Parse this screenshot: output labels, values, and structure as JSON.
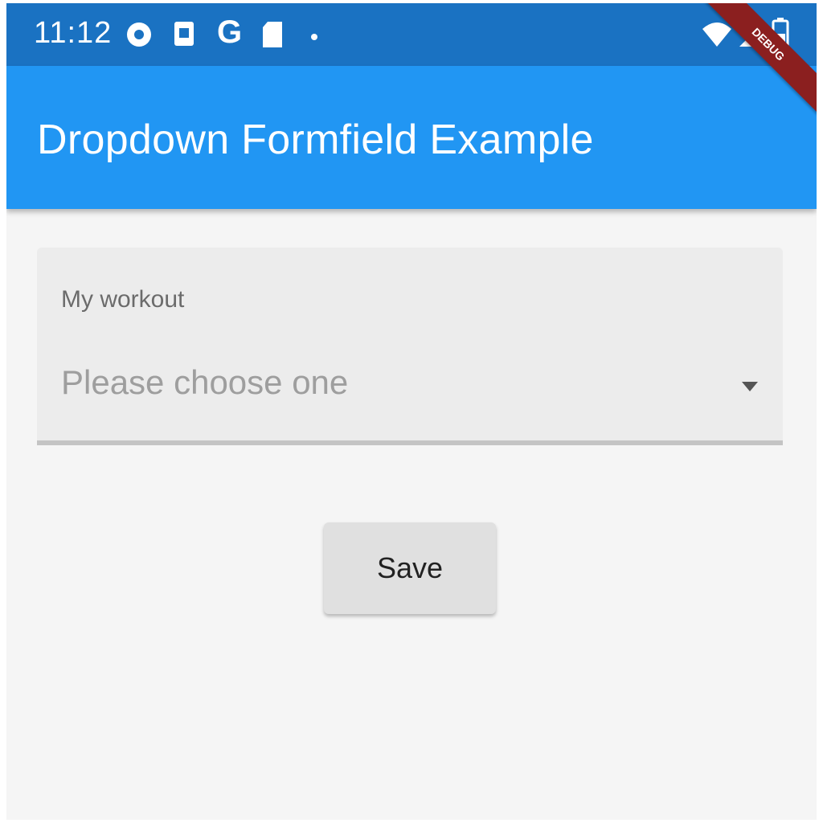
{
  "status_bar": {
    "time": "11:12",
    "left_icons": [
      "settings-circle-icon",
      "notification-icon",
      "google-g-icon",
      "sd-card-icon",
      "dot-icon"
    ],
    "right_icons": [
      "wifi-icon",
      "signal-icon",
      "battery-icon"
    ]
  },
  "app_bar": {
    "title": "Dropdown Formfield Example",
    "color": "#2196f3",
    "debug_banner": "DEBUG"
  },
  "form": {
    "dropdown": {
      "label": "My workout",
      "placeholder": "Please choose one",
      "icon": "arrow-drop-down-icon"
    },
    "save_label": "Save"
  }
}
